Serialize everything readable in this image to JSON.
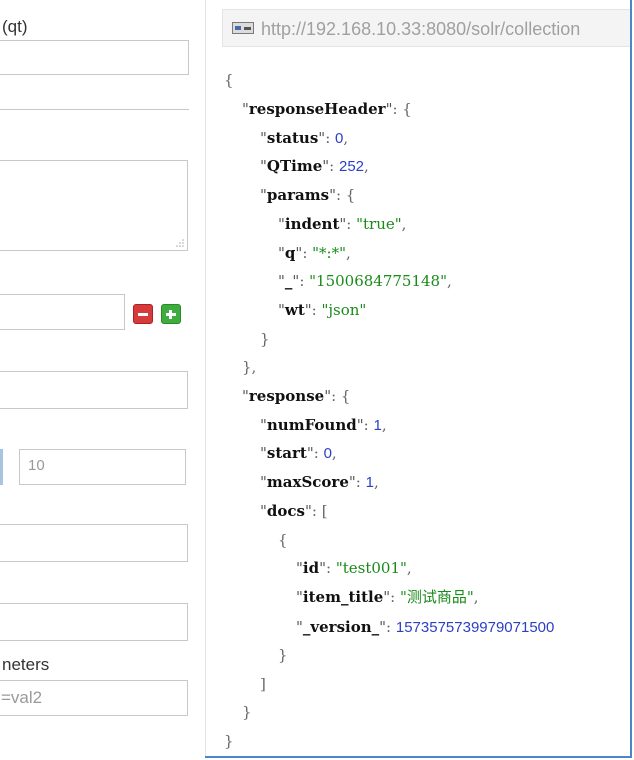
{
  "left": {
    "request_handler_label": "(qt)",
    "request_handler_value": "",
    "query_value": "",
    "filter_query_value": "",
    "sort_value": "",
    "start_value": "",
    "rows_value": "10",
    "field_list_value": "",
    "df_value": "",
    "raw_params_label": "neters",
    "raw_params_placeholder": "=val2"
  },
  "url_bar": {
    "url": "http://192.168.10.33:8080/solr/collection"
  },
  "response": {
    "lines": [
      [
        [
          "p",
          "{"
        ]
      ],
      [
        [
          "q",
          "\""
        ],
        [
          "k",
          "responseHeader"
        ],
        [
          "q",
          "\""
        ],
        [
          "p",
          ": {"
        ]
      ],
      [
        [
          "q",
          "\""
        ],
        [
          "k",
          "status"
        ],
        [
          "q",
          "\""
        ],
        [
          "p",
          ": "
        ],
        [
          "n",
          "0"
        ],
        [
          "p",
          ","
        ]
      ],
      [
        [
          "q",
          "\""
        ],
        [
          "k",
          "QTime"
        ],
        [
          "q",
          "\""
        ],
        [
          "p",
          ": "
        ],
        [
          "n",
          "252"
        ],
        [
          "p",
          ","
        ]
      ],
      [
        [
          "q",
          "\""
        ],
        [
          "k",
          "params"
        ],
        [
          "q",
          "\""
        ],
        [
          "p",
          ": {"
        ]
      ],
      [
        [
          "q",
          "\""
        ],
        [
          "k",
          "indent"
        ],
        [
          "q",
          "\""
        ],
        [
          "p",
          ": "
        ],
        [
          "s",
          "\"true\""
        ],
        [
          "p",
          ","
        ]
      ],
      [
        [
          "q",
          "\""
        ],
        [
          "k",
          "q"
        ],
        [
          "q",
          "\""
        ],
        [
          "p",
          ": "
        ],
        [
          "s",
          "\"*:*\""
        ],
        [
          "p",
          ","
        ]
      ],
      [
        [
          "q",
          "\""
        ],
        [
          "k",
          "_"
        ],
        [
          "q",
          "\""
        ],
        [
          "p",
          ": "
        ],
        [
          "s",
          "\"1500684775148\""
        ],
        [
          "p",
          ","
        ]
      ],
      [
        [
          "q",
          "\""
        ],
        [
          "k",
          "wt"
        ],
        [
          "q",
          "\""
        ],
        [
          "p",
          ": "
        ],
        [
          "s",
          "\"json\""
        ]
      ],
      [
        [
          "p",
          "}"
        ]
      ],
      [
        [
          "p",
          "},"
        ]
      ],
      [
        [
          "q",
          "\""
        ],
        [
          "k",
          "response"
        ],
        [
          "q",
          "\""
        ],
        [
          "p",
          ": {"
        ]
      ],
      [
        [
          "q",
          "\""
        ],
        [
          "k",
          "numFound"
        ],
        [
          "q",
          "\""
        ],
        [
          "p",
          ": "
        ],
        [
          "n",
          "1"
        ],
        [
          "p",
          ","
        ]
      ],
      [
        [
          "q",
          "\""
        ],
        [
          "k",
          "start"
        ],
        [
          "q",
          "\""
        ],
        [
          "p",
          ": "
        ],
        [
          "n",
          "0"
        ],
        [
          "p",
          ","
        ]
      ],
      [
        [
          "q",
          "\""
        ],
        [
          "k",
          "maxScore"
        ],
        [
          "q",
          "\""
        ],
        [
          "p",
          ": "
        ],
        [
          "n",
          "1"
        ],
        [
          "p",
          ","
        ]
      ],
      [
        [
          "q",
          "\""
        ],
        [
          "k",
          "docs"
        ],
        [
          "q",
          "\""
        ],
        [
          "p",
          ": ["
        ]
      ],
      [
        [
          "p",
          "{"
        ]
      ],
      [
        [
          "q",
          "\""
        ],
        [
          "k",
          "id"
        ],
        [
          "q",
          "\""
        ],
        [
          "p",
          ": "
        ],
        [
          "s",
          "\"test001\""
        ],
        [
          "p",
          ","
        ]
      ],
      [
        [
          "q",
          "\""
        ],
        [
          "k",
          "item_title"
        ],
        [
          "q",
          "\""
        ],
        [
          "p",
          ": "
        ],
        [
          "s",
          "\"测试商品\""
        ],
        [
          "p",
          ","
        ]
      ],
      [
        [
          "q",
          "\""
        ],
        [
          "k",
          "_version_"
        ],
        [
          "q",
          "\""
        ],
        [
          "p",
          ": "
        ],
        [
          "n",
          "1573575739979071500"
        ]
      ],
      [
        [
          "p",
          "}"
        ]
      ],
      [
        [
          "p",
          "]"
        ]
      ],
      [
        [
          "p",
          "}"
        ]
      ],
      [
        [
          "p",
          "}"
        ]
      ]
    ]
  },
  "colors": {
    "number": "#2b3fc7",
    "string": "#1a8a1a",
    "frame_border": "#4a86c8",
    "remove_button": "#d73a3a",
    "add_button": "#3eac3e"
  },
  "icons": {
    "url_icon": "document-link-icon",
    "remove": "minus-icon",
    "add": "plus-icon"
  }
}
